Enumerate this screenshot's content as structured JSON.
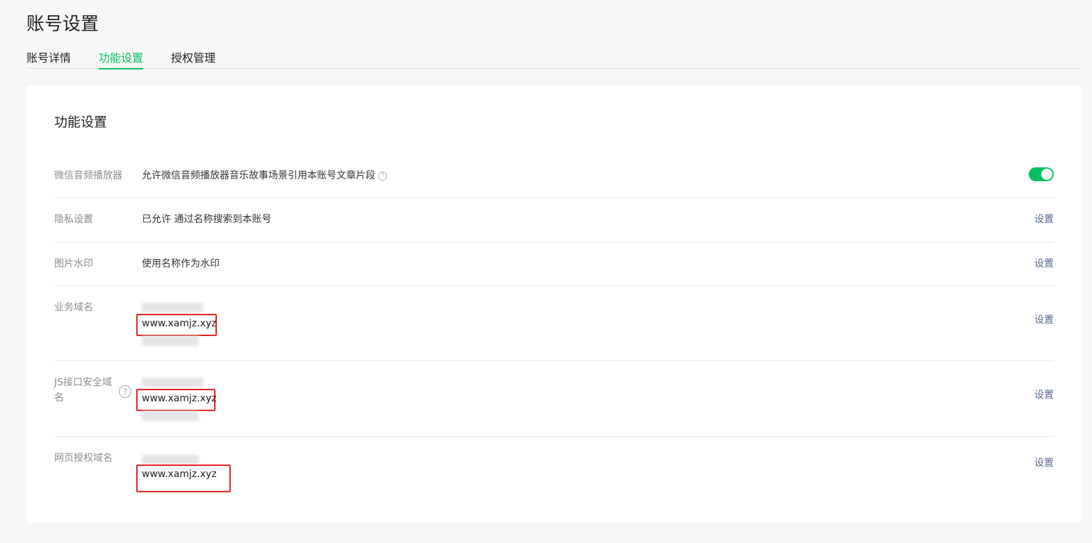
{
  "page": {
    "title": "账号设置"
  },
  "tabs": [
    {
      "label": "账号详情",
      "active": false
    },
    {
      "label": "功能设置",
      "active": true
    },
    {
      "label": "授权管理",
      "active": false
    }
  ],
  "section": {
    "title": "功能设置"
  },
  "rows": [
    {
      "label": "微信音频播放器",
      "desc": "允许微信音频播放器音乐故事场景引用本账号文章片段",
      "toggle_on": true
    },
    {
      "label": "隐私设置",
      "desc": "已允许 通过名称搜索到本账号",
      "action": "设置"
    },
    {
      "label": "图片水印",
      "desc": "使用名称作为水印",
      "action": "设置"
    },
    {
      "label": "业务域名",
      "domain": "www.xamjz.xyz",
      "action": "设置"
    },
    {
      "label": "JS接口安全域名",
      "domain": "www.xamjz.xyz",
      "action": "设置"
    },
    {
      "label": "网页授权域名",
      "domain": "www.xamjz.xyz",
      "action": "设置"
    }
  ],
  "colors": {
    "accent": "#07c160",
    "link": "#576b95",
    "highlight_border": "#e2231a"
  },
  "icons": {
    "help": "question-circle-icon"
  }
}
